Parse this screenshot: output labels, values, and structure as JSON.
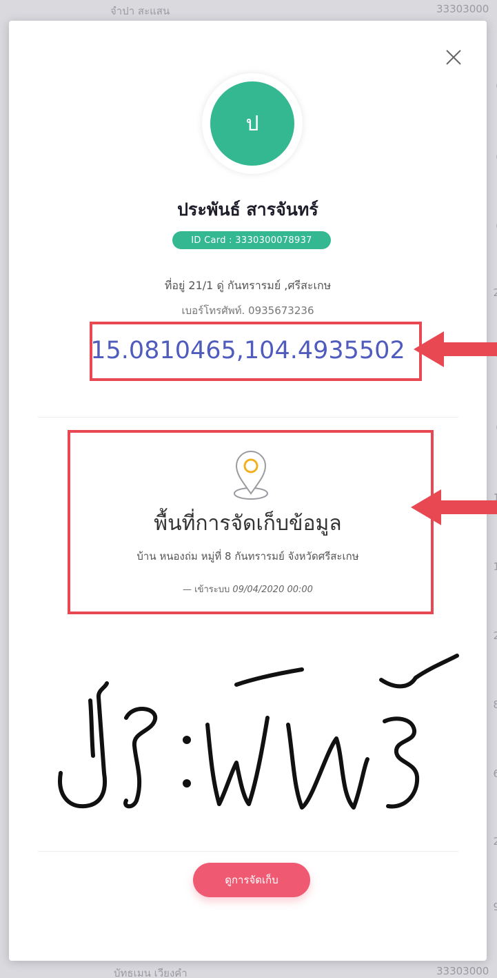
{
  "background": {
    "top_row_name": "จำปา สะแสน",
    "top_row_code": "33303000",
    "bottom_row_name": "บัทธเมน เวียงคำ",
    "bottom_row_code": "33303000",
    "right_edge_chars": [
      "(",
      "(",
      "(",
      "(",
      "2",
      "(",
      "(",
      "1",
      "1",
      "2",
      "8",
      "6",
      "2",
      "9"
    ]
  },
  "modal": {
    "close_icon": "close-icon",
    "avatar_initial": "ป",
    "avatar_color": "#33b891",
    "name": "ประพันธ์ สารจันทร์",
    "id_card": "ID Card : 3330300078937",
    "address": "ที่อยู่ 21/1 ดู่ กันทรารมย์ ,ศรีสะเกษ",
    "phone": "เบอร์โทรศัพท์. 0935673236",
    "coordinates": "15.0810465,104.4935502",
    "coordinates_color": "#4f5bbd",
    "area": {
      "icon": "location-pin-icon",
      "title": "พื้นที่การจัดเก็บข้อมูล",
      "address": "บ้าน หนองถ่ม หมู่ที่ 8 กันทรารมย์ จังหวัดศรีสะเกษ",
      "entry_label": "— เข้าระบบ",
      "entry_datetime": "09/04/2020 00:00"
    },
    "signature": "ประพันธ์",
    "view_button": "ดูการจัดเก็บ",
    "view_button_color": "#ef5a72"
  },
  "annotations": {
    "highlight_color": "#e84852"
  }
}
